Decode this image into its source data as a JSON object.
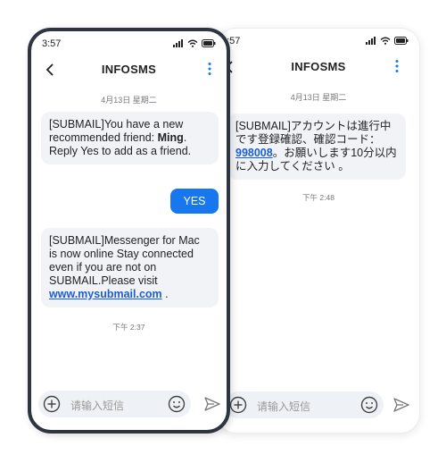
{
  "front": {
    "status": {
      "time": "3:57"
    },
    "header": {
      "title": "INFOSMS"
    },
    "date": "4月13日 星期二",
    "message1": {
      "prefix": "[SUBMAIL]You have a new recommended friend: ",
      "name": "Ming",
      "suffix": ". Reply Yes to add as a friend."
    },
    "reply": "YES",
    "message2": {
      "text": "[SUBMAIL]Messenger for Mac is now online Stay connected even if you are not on SUBMAIL.Please visit ",
      "link": "www.mysubmail.com",
      "tail": " ."
    },
    "timestamp": "下午 2:37",
    "input": {
      "placeholder": "请输入短信"
    }
  },
  "back": {
    "status": {
      "time": "3:57"
    },
    "header": {
      "title": "INFOSMS"
    },
    "date": "4月13日 星期二",
    "message1": {
      "prefix": "[SUBMAIL]アカウントは進行中です登録確認、確認コード：",
      "code": "998008",
      "suffix": "。お願いします10分以内に入力してください 。"
    },
    "timestamp": "下午 2:48",
    "input": {
      "placeholder": "请输入短信"
    }
  },
  "colors": {
    "accent": "#1677ee",
    "frame": "#2e3440",
    "bubble": "#f1f3f7",
    "link": "#1a5fd4"
  },
  "icons": [
    "signal-icon",
    "wifi-icon",
    "battery-icon",
    "back-arrow-icon",
    "more-vertical-icon",
    "plus-circle-icon",
    "emoji-icon",
    "send-icon"
  ]
}
